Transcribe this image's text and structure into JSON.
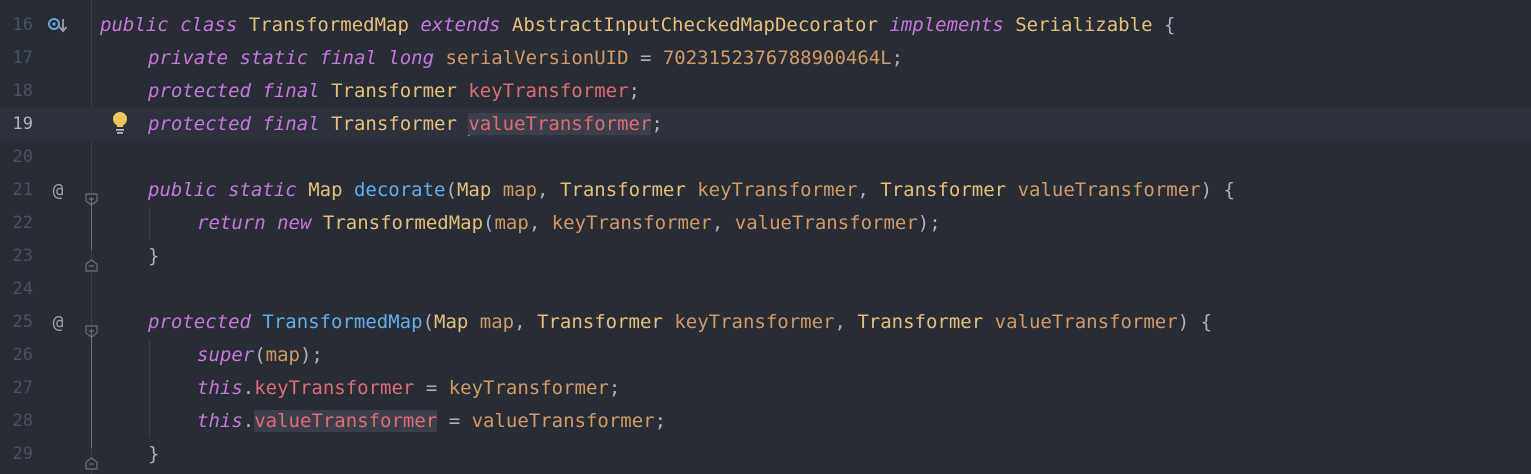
{
  "editor": {
    "lines": [
      {
        "num": "16",
        "marker": "override-icon",
        "indent": 0,
        "tokens": [
          {
            "t": "public",
            "c": "kw"
          },
          {
            "t": " ",
            "c": "pu"
          },
          {
            "t": "class",
            "c": "kw"
          },
          {
            "t": " ",
            "c": "pu"
          },
          {
            "t": "TransformedMap",
            "c": "ty"
          },
          {
            "t": " ",
            "c": "pu"
          },
          {
            "t": "extends",
            "c": "kw"
          },
          {
            "t": " ",
            "c": "pu"
          },
          {
            "t": "AbstractInputCheckedMapDecorator",
            "c": "ty"
          },
          {
            "t": " ",
            "c": "pu"
          },
          {
            "t": "implements",
            "c": "kw"
          },
          {
            "t": " ",
            "c": "pu"
          },
          {
            "t": "Serializable",
            "c": "ty"
          },
          {
            "t": " {",
            "c": "pu"
          }
        ]
      },
      {
        "num": "17",
        "indent": 1,
        "tokens": [
          {
            "t": "private",
            "c": "kw"
          },
          {
            "t": " ",
            "c": "pu"
          },
          {
            "t": "static",
            "c": "kw"
          },
          {
            "t": " ",
            "c": "pu"
          },
          {
            "t": "final",
            "c": "kw"
          },
          {
            "t": " ",
            "c": "pu"
          },
          {
            "t": "long",
            "c": "kw"
          },
          {
            "t": " ",
            "c": "pu"
          },
          {
            "t": "serialVersionUID",
            "c": "pa"
          },
          {
            "t": " = ",
            "c": "pu"
          },
          {
            "t": "7023152376788900464L",
            "c": "nm"
          },
          {
            "t": ";",
            "c": "pu"
          }
        ]
      },
      {
        "num": "18",
        "indent": 1,
        "tokens": [
          {
            "t": "protected",
            "c": "kw"
          },
          {
            "t": " ",
            "c": "pu"
          },
          {
            "t": "final",
            "c": "kw"
          },
          {
            "t": " ",
            "c": "pu"
          },
          {
            "t": "Transformer",
            "c": "ty"
          },
          {
            "t": " ",
            "c": "pu"
          },
          {
            "t": "keyTransformer",
            "c": "fd"
          },
          {
            "t": ";",
            "c": "pu"
          }
        ]
      },
      {
        "num": "19",
        "current": true,
        "indent": 1,
        "tokens": [
          {
            "t": "protected",
            "c": "kw"
          },
          {
            "t": " ",
            "c": "pu"
          },
          {
            "t": "final",
            "c": "kw"
          },
          {
            "t": " ",
            "c": "pu"
          },
          {
            "t": "Transformer",
            "c": "ty"
          },
          {
            "t": " ",
            "c": "pu"
          },
          {
            "t": "valueTransformer",
            "c": "fd",
            "caret": true,
            "hl": true
          },
          {
            "t": ";",
            "c": "pu"
          }
        ]
      },
      {
        "num": "20",
        "indent": 0,
        "tokens": []
      },
      {
        "num": "21",
        "marker": "at-icon",
        "fold": "start",
        "indent": 1,
        "tokens": [
          {
            "t": "public",
            "c": "kw"
          },
          {
            "t": " ",
            "c": "pu"
          },
          {
            "t": "static",
            "c": "kw"
          },
          {
            "t": " ",
            "c": "pu"
          },
          {
            "t": "Map",
            "c": "ty"
          },
          {
            "t": " ",
            "c": "pu"
          },
          {
            "t": "decorate",
            "c": "fn"
          },
          {
            "t": "(",
            "c": "pu"
          },
          {
            "t": "Map",
            "c": "ty"
          },
          {
            "t": " ",
            "c": "pu"
          },
          {
            "t": "map",
            "c": "pa"
          },
          {
            "t": ", ",
            "c": "pu"
          },
          {
            "t": "Transformer",
            "c": "ty"
          },
          {
            "t": " ",
            "c": "pu"
          },
          {
            "t": "keyTransformer",
            "c": "pa"
          },
          {
            "t": ", ",
            "c": "pu"
          },
          {
            "t": "Transformer",
            "c": "ty"
          },
          {
            "t": " ",
            "c": "pu"
          },
          {
            "t": "valueTransformer",
            "c": "pa"
          },
          {
            "t": ") {",
            "c": "pu"
          }
        ]
      },
      {
        "num": "22",
        "indent": 2,
        "tokens": [
          {
            "t": "return",
            "c": "kw"
          },
          {
            "t": " ",
            "c": "pu"
          },
          {
            "t": "new",
            "c": "kw"
          },
          {
            "t": " ",
            "c": "pu"
          },
          {
            "t": "TransformedMap",
            "c": "ty"
          },
          {
            "t": "(",
            "c": "pu"
          },
          {
            "t": "map",
            "c": "pa"
          },
          {
            "t": ", ",
            "c": "pu"
          },
          {
            "t": "keyTransformer",
            "c": "pa"
          },
          {
            "t": ", ",
            "c": "pu"
          },
          {
            "t": "valueTransformer",
            "c": "pa"
          },
          {
            "t": ");",
            "c": "pu"
          }
        ]
      },
      {
        "num": "23",
        "fold": "end",
        "indent": 1,
        "tokens": [
          {
            "t": "}",
            "c": "pu"
          }
        ]
      },
      {
        "num": "24",
        "indent": 0,
        "tokens": []
      },
      {
        "num": "25",
        "marker": "at-icon",
        "fold": "start",
        "indent": 1,
        "tokens": [
          {
            "t": "protected",
            "c": "kw"
          },
          {
            "t": " ",
            "c": "pu"
          },
          {
            "t": "TransformedMap",
            "c": "fn"
          },
          {
            "t": "(",
            "c": "pu"
          },
          {
            "t": "Map",
            "c": "ty"
          },
          {
            "t": " ",
            "c": "pu"
          },
          {
            "t": "map",
            "c": "pa"
          },
          {
            "t": ", ",
            "c": "pu"
          },
          {
            "t": "Transformer",
            "c": "ty"
          },
          {
            "t": " ",
            "c": "pu"
          },
          {
            "t": "keyTransformer",
            "c": "pa"
          },
          {
            "t": ", ",
            "c": "pu"
          },
          {
            "t": "Transformer",
            "c": "ty"
          },
          {
            "t": " ",
            "c": "pu"
          },
          {
            "t": "valueTransformer",
            "c": "pa"
          },
          {
            "t": ") {",
            "c": "pu"
          }
        ]
      },
      {
        "num": "26",
        "indent": 2,
        "tokens": [
          {
            "t": "super",
            "c": "kw"
          },
          {
            "t": "(",
            "c": "pu"
          },
          {
            "t": "map",
            "c": "pa"
          },
          {
            "t": ");",
            "c": "pu"
          }
        ]
      },
      {
        "num": "27",
        "indent": 2,
        "tokens": [
          {
            "t": "this",
            "c": "kw"
          },
          {
            "t": ".",
            "c": "pu"
          },
          {
            "t": "keyTransformer",
            "c": "fd"
          },
          {
            "t": " = ",
            "c": "pu"
          },
          {
            "t": "keyTransformer",
            "c": "pa"
          },
          {
            "t": ";",
            "c": "pu"
          }
        ]
      },
      {
        "num": "28",
        "indent": 2,
        "tokens": [
          {
            "t": "this",
            "c": "kw"
          },
          {
            "t": ".",
            "c": "pu"
          },
          {
            "t": "valueTransformer",
            "c": "fd",
            "hl": true
          },
          {
            "t": " = ",
            "c": "pu"
          },
          {
            "t": "valueTransformer",
            "c": "pa"
          },
          {
            "t": ";",
            "c": "pu"
          }
        ]
      },
      {
        "num": "29",
        "fold": "end",
        "indent": 1,
        "tokens": [
          {
            "t": "}",
            "c": "pu"
          }
        ]
      }
    ],
    "gutter_icons": {
      "override-icon": "o↓",
      "at-icon": "@",
      "intention-bulb-icon": "💡"
    },
    "colors": {
      "background": "#282c34",
      "keyword": "#c678dd",
      "type": "#e5c07b",
      "function": "#61afef",
      "field": "#e06c75",
      "parameter": "#d19a66",
      "caret": "#528bff",
      "bulb": "#f2c55c"
    }
  }
}
